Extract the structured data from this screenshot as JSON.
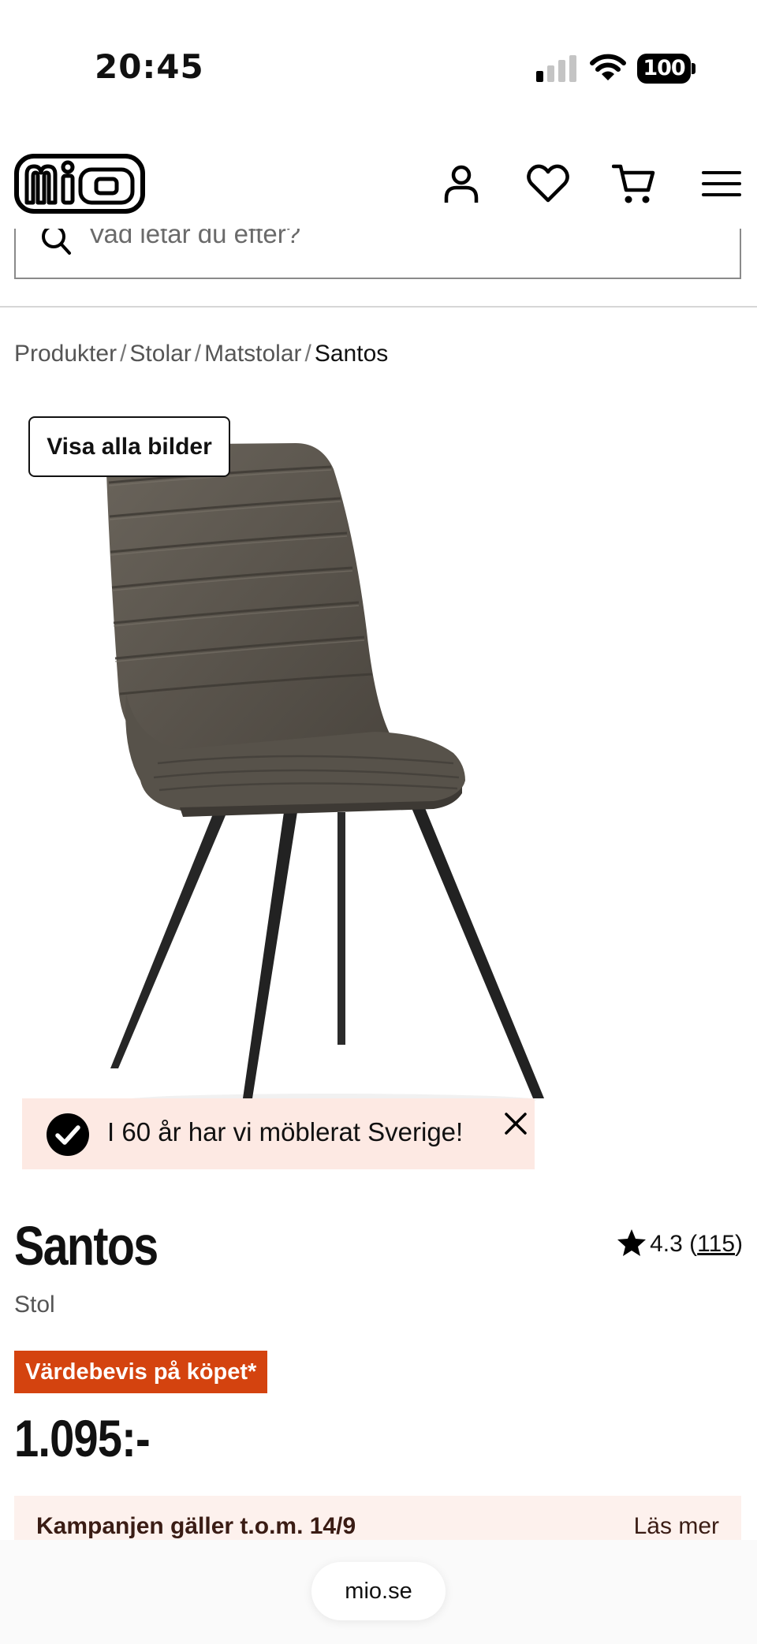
{
  "status_bar": {
    "time": "20:45",
    "battery": "100"
  },
  "header": {
    "logo_text": "mio",
    "icons": [
      "user-icon",
      "heart-icon",
      "cart-icon",
      "menu-icon"
    ]
  },
  "search": {
    "placeholder": "Vad letar du efter?"
  },
  "breadcrumb": {
    "items": [
      "Produkter",
      "Stolar",
      "Matstolar"
    ],
    "current": "Santos",
    "separator": "/"
  },
  "gallery": {
    "show_all_label": "Visa alla bilder"
  },
  "notice": {
    "text": "I 60 år har vi möblerat Sverige!"
  },
  "product": {
    "title": "Santos",
    "subtitle": "Stol",
    "rating": "4.3",
    "review_count": "115",
    "promo_badge": "Värdebevis på köpet*",
    "price": "1.095:-"
  },
  "campaign": {
    "text": "Kampanjen gäller t.o.m. 14/9",
    "link": "Läs mer"
  },
  "browser": {
    "url": "mio.se"
  },
  "colors": {
    "promo": "#d4430f",
    "notice_bg": "#fde9e3",
    "campaign_bg": "#fdf1ed",
    "chair_fabric": "#57524a"
  }
}
